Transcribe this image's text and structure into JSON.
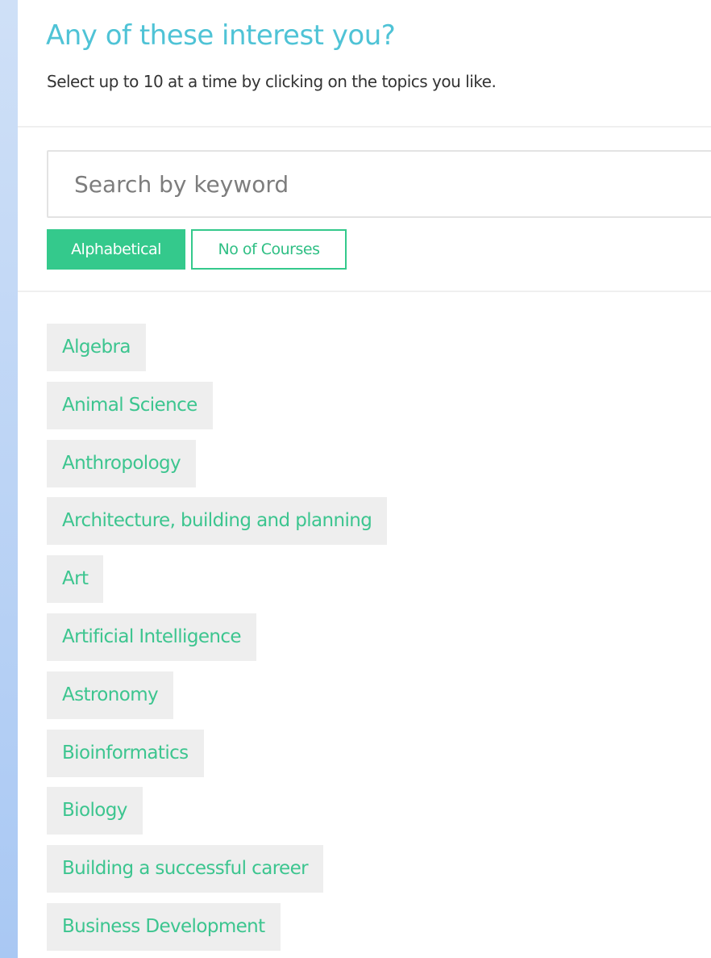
{
  "header": {
    "title": "Any of these interest you?",
    "subtitle": "Select up to 10 at a time by clicking on the topics you like."
  },
  "search": {
    "placeholder": "Search by keyword",
    "value": ""
  },
  "sort": {
    "alphabetical_label": "Alphabetical",
    "courses_label": "No of Courses",
    "selected": "Alphabetical"
  },
  "topics": [
    {
      "label": "Algebra"
    },
    {
      "label": "Animal Science"
    },
    {
      "label": "Anthropology"
    },
    {
      "label": "Architecture, building and planning"
    },
    {
      "label": "Art"
    },
    {
      "label": "Artificial Intelligence"
    },
    {
      "label": "Astronomy"
    },
    {
      "label": "Bioinformatics"
    },
    {
      "label": "Biology"
    },
    {
      "label": "Building a successful career"
    },
    {
      "label": "Business Development"
    }
  ],
  "colors": {
    "title": "#4fc3d6",
    "accent": "#34c98c",
    "topic_text": "#3cc58f",
    "topic_bg": "#eeeeee",
    "background": "#a9c8f3"
  }
}
